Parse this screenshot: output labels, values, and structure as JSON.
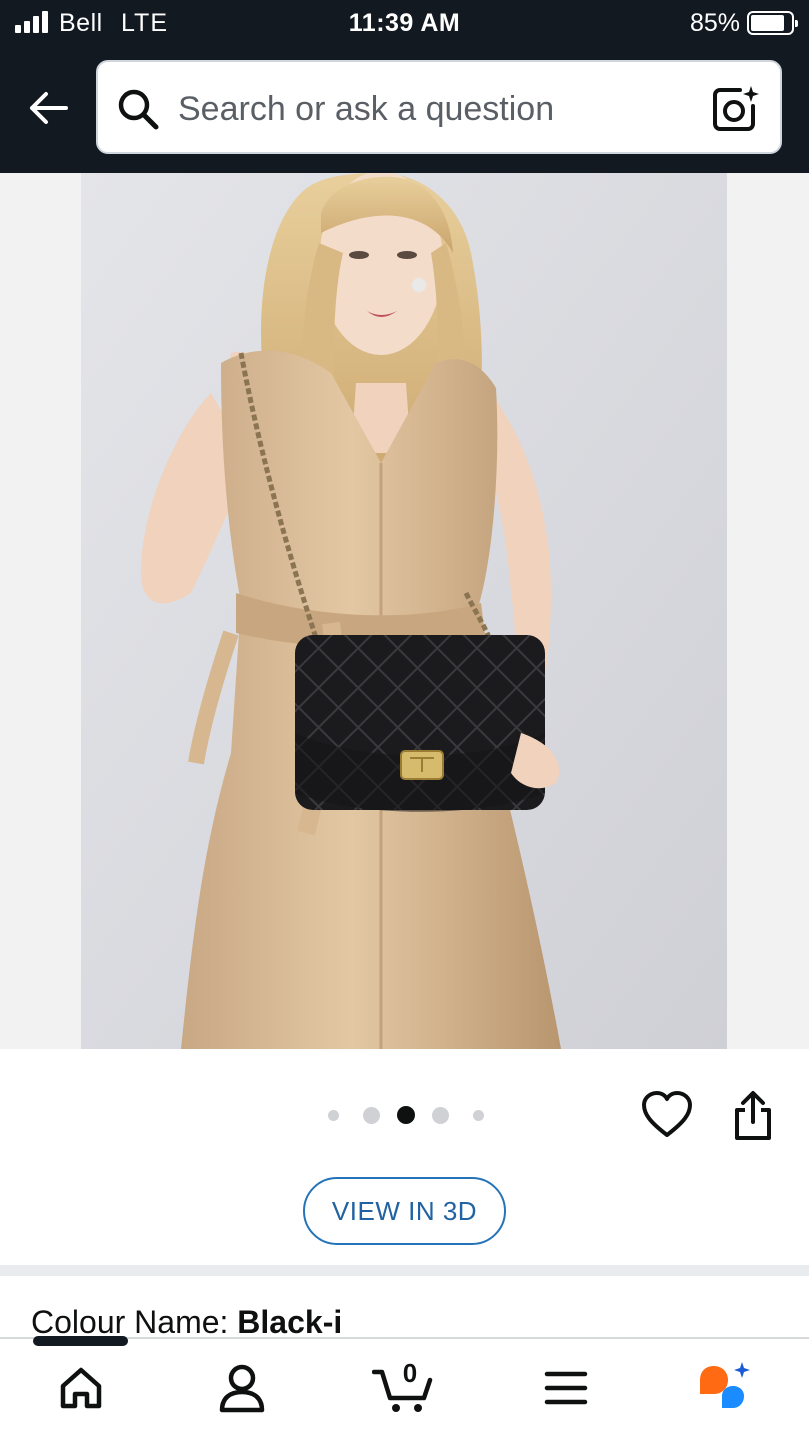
{
  "status_bar": {
    "carrier": "Bell",
    "network": "LTE",
    "time": "11:39 AM",
    "battery": "85%",
    "battery_level": 0.85
  },
  "header": {
    "back_icon": "back-arrow-icon",
    "search": {
      "placeholder": "Search or ask a question",
      "value": "",
      "icon": "search-icon",
      "camera_icon": "camera-lens-icon"
    }
  },
  "product": {
    "image_alt": "Woman in satin dress with black quilted chain shoulder bag",
    "gallery": {
      "count": 5,
      "active_index": 2
    },
    "actions": {
      "wishlist_icon": "heart-icon",
      "share_icon": "share-icon"
    },
    "view_3d_label": "VIEW IN 3D",
    "colour_label": "Colour Name: ",
    "colour_value": "Black-i"
  },
  "bottom_nav": {
    "items": [
      {
        "icon": "home-icon"
      },
      {
        "icon": "account-icon"
      },
      {
        "icon": "cart-icon",
        "count": "0"
      },
      {
        "icon": "menu-icon"
      },
      {
        "icon": "rufus-assistant-icon"
      }
    ]
  },
  "colors": {
    "header_bg": "#131921",
    "link_blue": "#2162a1",
    "divider": "#e9ecef"
  }
}
